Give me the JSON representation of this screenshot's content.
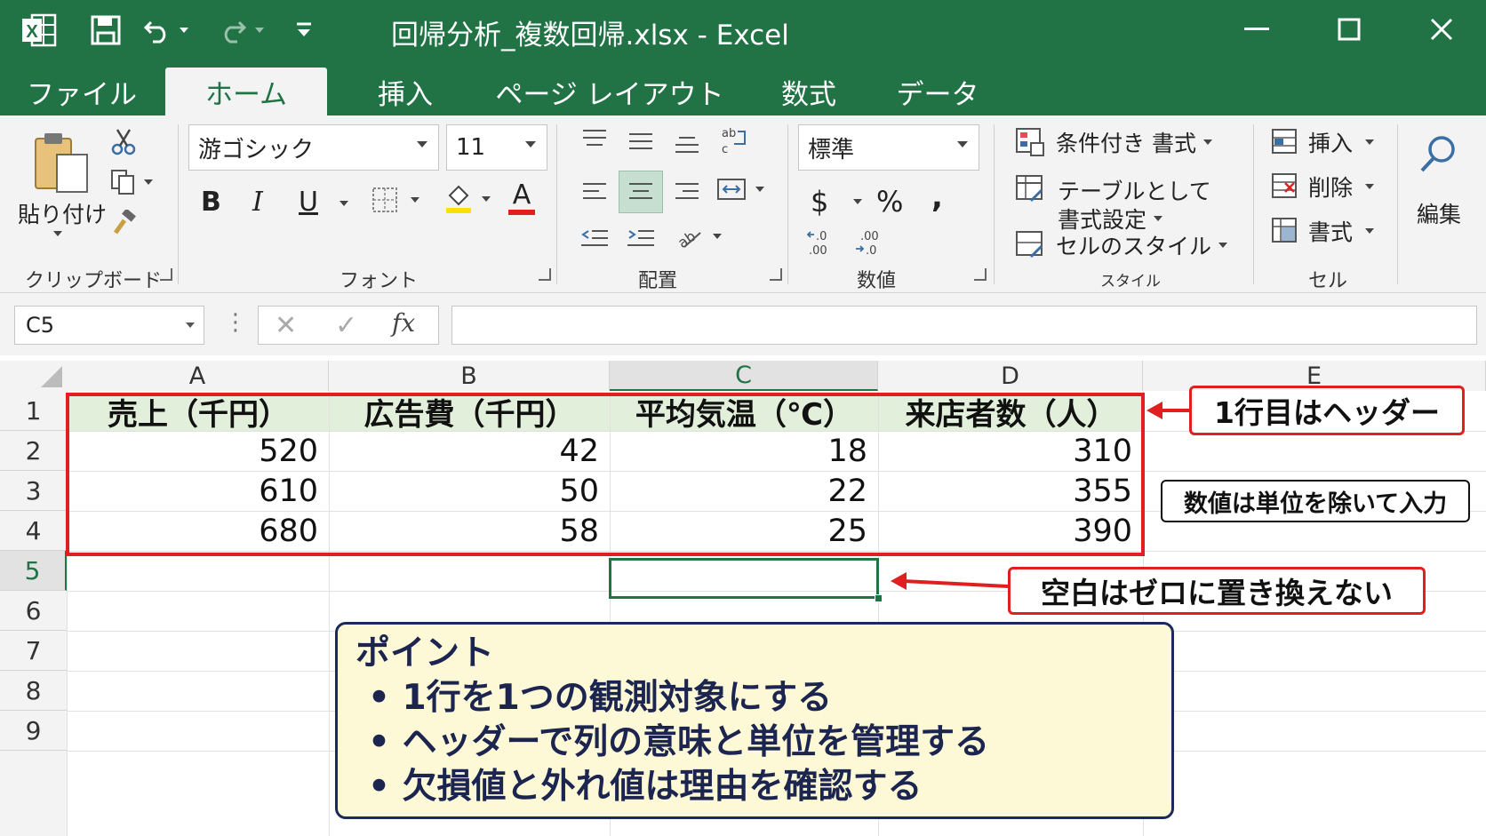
{
  "titlebar": {
    "document_title": "回帰分析_複数回帰.xlsx  -  Excel",
    "app_logo": "X",
    "icons": [
      "excel-logo-icon",
      "save-icon",
      "undo-icon",
      "redo-icon",
      "customize-qat-icon",
      "minimize-icon",
      "maximize-icon",
      "close-icon"
    ]
  },
  "tabs": [
    {
      "label": "ファイル"
    },
    {
      "label": "ホーム"
    },
    {
      "label": "挿入"
    },
    {
      "label": "ページ レイアウト"
    },
    {
      "label": "数式"
    },
    {
      "label": "データ"
    }
  ],
  "ribbon": {
    "clipboard": {
      "paste_label": "貼り付け",
      "group_label": "クリップボード"
    },
    "font": {
      "font_name": "游ゴシック",
      "font_size": "11",
      "bold": "B",
      "italic": "I",
      "underline": "U",
      "font_color_glyph": "A",
      "group_label": "フォント"
    },
    "alignment": {
      "group_label": "配置"
    },
    "number": {
      "format": "標準",
      "currency": "$",
      "percent": "%",
      "comma": ",",
      "inc_decimal": "←.0\n.00",
      "dec_decimal": ".00\n→.0",
      "group_label": "数値"
    },
    "styles": {
      "conditional": "条件付き 書式",
      "table_line1": "テーブルとして",
      "table_line2": "書式設定",
      "cell_styles": "セルのスタイル",
      "group_label": "スタイル"
    },
    "cells": {
      "insert": "挿入",
      "delete": "削除",
      "format": "書式",
      "group_label": "セル"
    },
    "editing": {
      "label": "編集"
    }
  },
  "formula_bar": {
    "name_box": "C5",
    "fx": "fx",
    "formula": ""
  },
  "sheet": {
    "columns": [
      "A",
      "B",
      "C",
      "D",
      "E"
    ],
    "rows": [
      "1",
      "2",
      "3",
      "4",
      "5",
      "6",
      "7",
      "8",
      "9"
    ],
    "header_row": [
      "売上（千円）",
      "広告費（千円）",
      "平均気温（℃）",
      "来店者数（人）"
    ],
    "data": [
      [
        "520",
        "42",
        "18",
        "310"
      ],
      [
        "610",
        "50",
        "22",
        "355"
      ],
      [
        "680",
        "58",
        "25",
        "390"
      ]
    ],
    "selected_cell": "C5"
  },
  "annotations": {
    "header_note": "1行目はヘッダー",
    "unit_note": "数値は単位を除いて入力",
    "blank_note": "空白はゼロに置き換えない"
  },
  "points": {
    "title": "ポイント",
    "items": [
      "1行を1つの観測対象にする",
      "ヘッダーで列の意味と単位を管理する",
      "欠損値と外れ値は理由を確認する"
    ]
  },
  "colors": {
    "excel_green": "#217346",
    "header_fill": "#e2efda",
    "callout_red": "#e02020",
    "point_fill": "#fdf8d5",
    "point_border": "#1b2a5a"
  }
}
